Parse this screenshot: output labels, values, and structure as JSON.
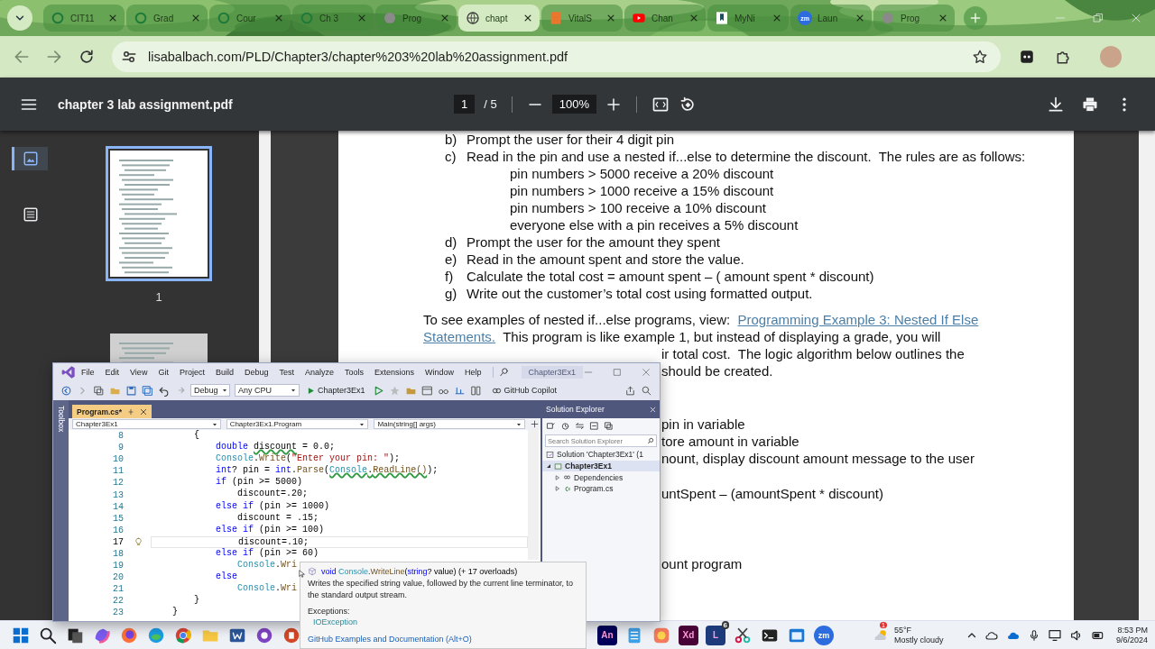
{
  "browser": {
    "tabs": [
      {
        "label": "CIT11",
        "kind": "ring",
        "selected": false
      },
      {
        "label": "Grad",
        "kind": "ring",
        "selected": false
      },
      {
        "label": "Cour",
        "kind": "ring",
        "selected": false
      },
      {
        "label": "Ch 3",
        "kind": "ring",
        "selected": false
      },
      {
        "label": "Prog",
        "kind": "gray",
        "selected": false
      },
      {
        "label": "chapt",
        "kind": "globe",
        "selected": true
      },
      {
        "label": "VitalS",
        "kind": "orange",
        "selected": false
      },
      {
        "label": "Chan",
        "kind": "video",
        "selected": false
      },
      {
        "label": "MyNi",
        "kind": "bookmark",
        "selected": false
      },
      {
        "label": "Laun",
        "kind": "zoom",
        "icon_text": "zm",
        "selected": false
      },
      {
        "label": "Prog",
        "kind": "gray",
        "selected": false
      }
    ],
    "url": "lisabalbach.com/PLD/Chapter3/chapter%203%20lab%20assignment.pdf"
  },
  "pdf_toolbar": {
    "title": "chapter 3 lab assignment.pdf",
    "page": "1",
    "page_total": "/ 5",
    "zoom": "100%"
  },
  "sidebar": {
    "views": [
      {
        "kind": "thumbnails",
        "selected": true
      },
      {
        "kind": "outline",
        "selected": false
      }
    ],
    "thumbnails": [
      {
        "label": "1",
        "selected": true
      },
      {
        "selected": false
      }
    ]
  },
  "document": {
    "items_top": [
      {
        "marker": "b)",
        "text": "Prompt the user for their 4 digit pin"
      },
      {
        "marker": "c)",
        "text": "Read in the pin and use a nested if...else to determine the discount.  The rules are as follows:"
      }
    ],
    "rules": [
      "pin numbers > 5000 receive a 20% discount",
      "pin numbers > 1000 receive a 15% discount",
      "pin numbers > 100 receive a 10% discount",
      "everyone else with a pin receives a 5% discount"
    ],
    "items_bottom": [
      {
        "marker": "d)",
        "text": "Prompt the user for the amount they spent"
      },
      {
        "marker": "e)",
        "text": "Read in the amount spent and store the value."
      },
      {
        "marker": "f)",
        "text": "Calculate the total cost = amount spent – ( amount spent * discount)"
      },
      {
        "marker": "g)",
        "text": "Write out the customer’s total cost using formatted output."
      }
    ],
    "intro": "To see examples of nested if...else programs, view:",
    "link_parts": [
      "Programming Example 3: Nested If Else",
      "Statements."
    ],
    "after_link": "This program is like example 1, but instead of displaying a grade, you will",
    "fragments": [
      "ir total cost.  The logic algorithm below outlines the",
      "should be created.",
      "pin in variable",
      "tore amount in variable",
      "nount, display discount amount message to the user",
      "untSpent – (amountSpent * discount)",
      "ount program"
    ]
  },
  "vs": {
    "menu": [
      "File",
      "Edit",
      "View",
      "Git",
      "Project",
      "Build",
      "Debug",
      "Test",
      "Analyze",
      "Tools",
      "Extensions",
      "Window",
      "Help"
    ],
    "title": "Chapter3Ex1",
    "config": "Debug",
    "platform": "Any CPU",
    "run_target": "Chapter3Ex1",
    "copilot": "GitHub Copilot",
    "toolbox": "Toolbox",
    "doc_tabs": [
      {
        "label": "Program.cs*",
        "selected": true
      }
    ],
    "nav": [
      "Chapter3Ex1",
      "Chapter3Ex1.Program",
      "Main(string[] args)"
    ],
    "code": [
      {
        "n": "8",
        "current": false,
        "tokens": [
          {
            "kind": "plain",
            "text": "        {",
            "squiggle": false
          }
        ]
      },
      {
        "n": "9",
        "current": false,
        "tokens": [
          {
            "kind": "keyword",
            "text": "            double",
            "squiggle": false
          },
          {
            "kind": "plain",
            "text": " discount",
            "squiggle": true
          },
          {
            "kind": "plain",
            "text": " = 0.0;",
            "squiggle": false
          }
        ]
      },
      {
        "n": "10",
        "current": false,
        "tokens": [
          {
            "kind": "type",
            "text": "            Console",
            "squiggle": false
          },
          {
            "kind": "plain",
            "text": ".",
            "squiggle": false
          },
          {
            "kind": "method",
            "text": "Write",
            "squiggle": false
          },
          {
            "kind": "plain",
            "text": "(",
            "squiggle": false
          },
          {
            "kind": "string",
            "text": "\"Enter your pin: \"",
            "squiggle": false
          },
          {
            "kind": "plain",
            "text": ");",
            "squiggle": false
          }
        ]
      },
      {
        "n": "11",
        "current": false,
        "tokens": [
          {
            "kind": "keyword",
            "text": "            int",
            "squiggle": false
          },
          {
            "kind": "plain",
            "text": "? pin = ",
            "squiggle": false
          },
          {
            "kind": "keyword",
            "text": "int",
            "squiggle": false
          },
          {
            "kind": "plain",
            "text": ".",
            "squiggle": false
          },
          {
            "kind": "method",
            "text": "Parse",
            "squiggle": false
          },
          {
            "kind": "plain",
            "text": "(",
            "squiggle": false
          },
          {
            "kind": "type",
            "text": "Console",
            "squiggle": true
          },
          {
            "kind": "plain",
            "text": ".",
            "squiggle": true
          },
          {
            "kind": "method",
            "text": "ReadLine()",
            "squiggle": true
          },
          {
            "kind": "plain",
            "text": ");",
            "squiggle": false
          }
        ]
      },
      {
        "n": "12",
        "current": false,
        "tokens": [
          {
            "kind": "keyword",
            "text": "            if",
            "squiggle": false
          },
          {
            "kind": "plain",
            "text": " (pin >= 5000)",
            "squiggle": false
          }
        ]
      },
      {
        "n": "13",
        "current": false,
        "tokens": [
          {
            "kind": "plain",
            "text": "                discount=.20;",
            "squiggle": false
          }
        ]
      },
      {
        "n": "14",
        "current": false,
        "tokens": [
          {
            "kind": "keyword",
            "text": "            else if",
            "squiggle": false
          },
          {
            "kind": "plain",
            "text": " (pin >= 1000)",
            "squiggle": false
          }
        ]
      },
      {
        "n": "15",
        "current": false,
        "tokens": [
          {
            "kind": "plain",
            "text": "                discount = .15;",
            "squiggle": false
          }
        ]
      },
      {
        "n": "16",
        "current": false,
        "tokens": [
          {
            "kind": "keyword",
            "text": "            else if",
            "squiggle": false
          },
          {
            "kind": "plain",
            "text": " (pin >= 100)",
            "squiggle": false
          }
        ]
      },
      {
        "n": "17",
        "current": true,
        "tokens": [
          {
            "kind": "plain",
            "text": "                discount=.10;",
            "squiggle": false
          }
        ]
      },
      {
        "n": "18",
        "current": false,
        "tokens": [
          {
            "kind": "keyword",
            "text": "            else if",
            "squiggle": false
          },
          {
            "kind": "plain",
            "text": " (pin >= 60)",
            "squiggle": false
          }
        ]
      },
      {
        "n": "19",
        "current": false,
        "tokens": [
          {
            "kind": "type",
            "text": "                Console",
            "squiggle": false
          },
          {
            "kind": "plain",
            "text": ".",
            "squiggle": false
          },
          {
            "kind": "method",
            "text": "Wri",
            "squiggle": false
          }
        ]
      },
      {
        "n": "20",
        "current": false,
        "tokens": [
          {
            "kind": "keyword",
            "text": "            else",
            "squiggle": false
          }
        ]
      },
      {
        "n": "21",
        "current": false,
        "tokens": [
          {
            "kind": "type",
            "text": "                Console",
            "squiggle": false
          },
          {
            "kind": "plain",
            "text": ".",
            "squiggle": false
          },
          {
            "kind": "method",
            "text": "Wri",
            "squiggle": false
          }
        ]
      },
      {
        "n": "22",
        "current": false,
        "tokens": [
          {
            "kind": "plain",
            "text": "        }",
            "squiggle": false
          }
        ]
      },
      {
        "n": "23",
        "current": false,
        "tokens": [
          {
            "kind": "plain",
            "text": "    }",
            "squiggle": false
          }
        ]
      }
    ],
    "solution_explorer": {
      "title": "Solution Explorer",
      "search_placeholder": "Search Solution Explorer",
      "tree": [
        {
          "label": "Solution 'Chapter3Ex1' (1",
          "kind": "solution",
          "selected": false
        },
        {
          "label": "Chapter3Ex1",
          "kind": "project",
          "selected": true,
          "expanded": true,
          "children": [
            {
              "label": "Dependencies",
              "kind": "deps",
              "selected": false,
              "expanded": false
            },
            {
              "label": "Program.cs",
              "kind": "cs",
              "selected": false,
              "expanded": false
            }
          ]
        }
      ]
    }
  },
  "tooltip": {
    "signature": [
      {
        "kind": "keyword",
        "text": "void"
      },
      {
        "kind": "type",
        "text": " Console"
      },
      {
        "kind": "plain",
        "text": "."
      },
      {
        "kind": "method",
        "text": "WriteLine"
      },
      {
        "kind": "plain",
        "text": "("
      },
      {
        "kind": "keyword",
        "text": "string"
      },
      {
        "kind": "plain",
        "text": "? value) (+ 17 overloads)"
      }
    ],
    "description": "Writes the specified string value, followed by the current line terminator, to the standard output stream.",
    "exceptions_label": "Exceptions:",
    "exceptions": [
      "IOException"
    ],
    "link": "GitHub Examples and Documentation (Alt+O)"
  },
  "taskbar": {
    "apps_left": [
      {
        "kind": "windows"
      },
      {
        "kind": "search"
      },
      {
        "kind": "taskview"
      },
      {
        "kind": "copilot"
      },
      {
        "kind": "firefox"
      },
      {
        "kind": "edge"
      },
      {
        "kind": "chrome"
      },
      {
        "kind": "folder"
      },
      {
        "kind": "word"
      },
      {
        "kind": "github"
      },
      {
        "kind": "powerpoint"
      }
    ],
    "apps_right": [
      {
        "kind": "tile",
        "label": "An",
        "color": "#00005b"
      },
      {
        "kind": "notepad"
      },
      {
        "kind": "photos"
      },
      {
        "kind": "tile",
        "label": "Xd",
        "color": "#470137"
      },
      {
        "kind": "tile",
        "label": "L",
        "color": "#1d3b7a",
        "badge": "6"
      },
      {
        "kind": "snip"
      },
      {
        "kind": "terminal"
      },
      {
        "kind": "window"
      },
      {
        "kind": "zoom",
        "label": "zm"
      }
    ],
    "weather": {
      "badge": "1",
      "temp": "55°F",
      "condition": "Mostly cloudy"
    },
    "time": "8:53 PM",
    "date": "9/6/2024"
  }
}
